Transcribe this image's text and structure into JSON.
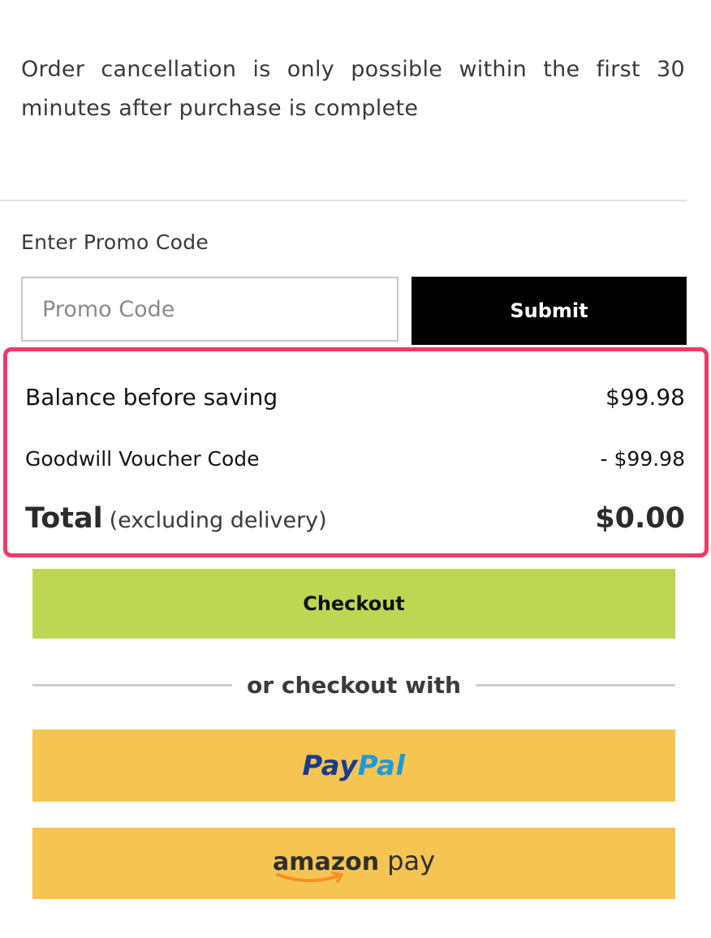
{
  "notice": {
    "text": "Order cancellation is only possible within the first 30 minutes after purchase is complete"
  },
  "promo": {
    "label": "Enter Promo Code",
    "placeholder": "Promo Code",
    "value": "",
    "submit_label": "Submit"
  },
  "summary": {
    "highlight_color": "#ef3a67",
    "balance_label": "Balance before saving",
    "balance_value": "$99.98",
    "voucher_label": "Goodwill Voucher Code",
    "voucher_value": "- $99.98",
    "total_label": "Total",
    "total_note": "(excluding delivery)",
    "total_value": "$0.00"
  },
  "checkout": {
    "label": "Checkout",
    "color": "#bdd753"
  },
  "alt_checkout": {
    "divider_text": "or checkout with",
    "paypal": {
      "logo_part1": "Pay",
      "logo_part2": "Pal",
      "icon": "paypal-logo"
    },
    "amazon": {
      "logo_word": "amazon",
      "logo_pay": "pay",
      "icon": "amazon-pay-logo"
    },
    "button_color": "#f5c453"
  }
}
